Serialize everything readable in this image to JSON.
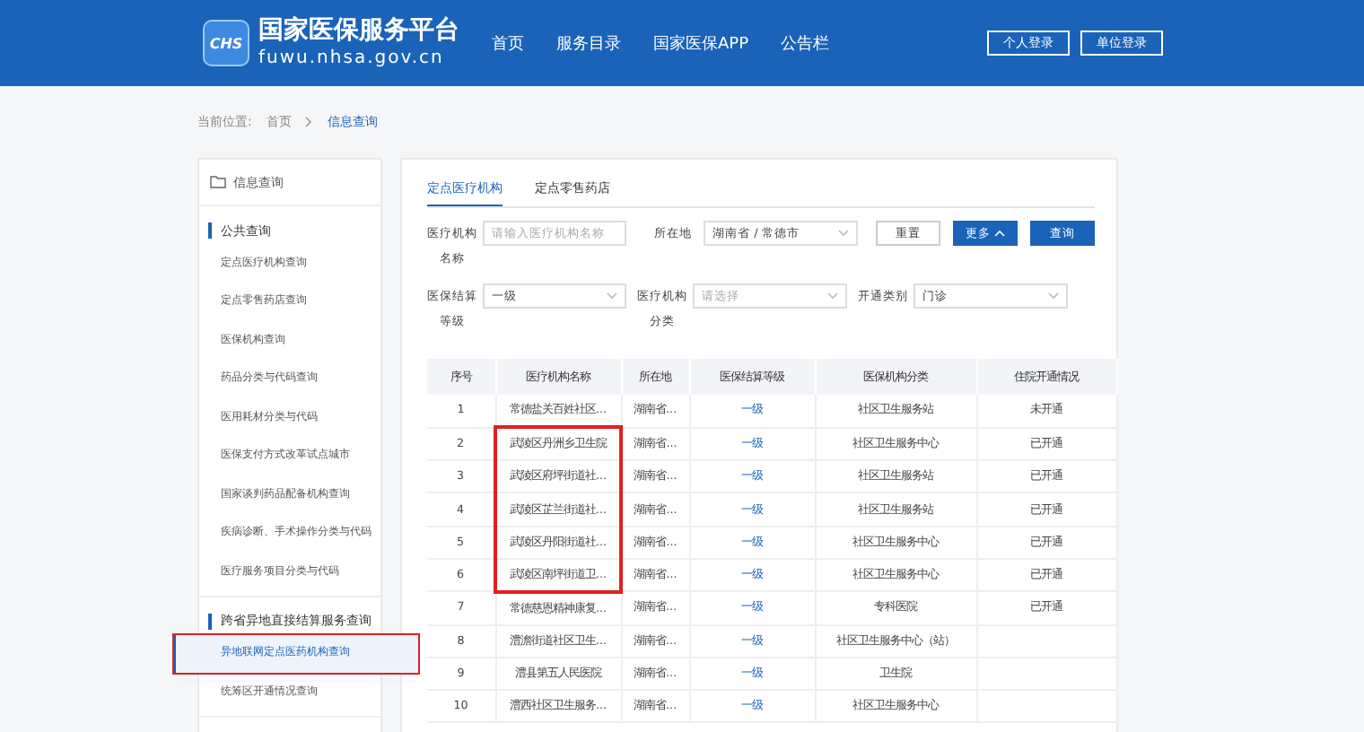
{
  "header": {
    "logo_badge": "CHS",
    "site_name": "国家医保服务平台",
    "site_url": "fuwu.nhsa.gov.cn",
    "nav": [
      {
        "label": "首页"
      },
      {
        "label": "服务目录"
      },
      {
        "label": "国家医保APP"
      },
      {
        "label": "公告栏"
      }
    ],
    "login_buttons": [
      "个人登录",
      "单位登录"
    ]
  },
  "breadcrumb": {
    "prefix": "当前位置:",
    "items": [
      {
        "label": "首页",
        "current": false
      },
      {
        "label": "信息查询",
        "current": true
      }
    ]
  },
  "sidebar": {
    "title": "信息查询",
    "groups": [
      {
        "title": "公共查询",
        "items": [
          {
            "label": "定点医疗机构查询",
            "selected": false,
            "circled": false
          },
          {
            "label": "定点零售药店查询",
            "selected": false,
            "circled": false
          },
          {
            "label": "医保机构查询",
            "selected": false,
            "circled": false
          },
          {
            "label": "药品分类与代码查询",
            "selected": false,
            "circled": false
          },
          {
            "label": "医用耗材分类与代码",
            "selected": false,
            "circled": false
          },
          {
            "label": "医保支付方式改革试点城市",
            "selected": false,
            "circled": false
          },
          {
            "label": "国家谈判药品配备机构查询",
            "selected": false,
            "circled": false
          },
          {
            "label": "疾病诊断、手术操作分类与代码",
            "selected": false,
            "circled": false
          },
          {
            "label": "医疗服务项目分类与代码",
            "selected": false,
            "circled": false
          }
        ]
      },
      {
        "title": "跨省异地直接结算服务查询",
        "items": [
          {
            "label": "异地联网定点医药机构查询",
            "selected": true,
            "circled": true
          },
          {
            "label": "统筹区开通情况查询",
            "selected": false,
            "circled": false
          }
        ]
      }
    ]
  },
  "tabs": [
    {
      "label": "定点医疗机构",
      "selected": true
    },
    {
      "label": "定点零售药店",
      "selected": false
    }
  ],
  "filters": [
    {
      "label": "医疗机构名称",
      "kind": "input",
      "placeholder": "请输入医疗机构名称"
    },
    {
      "label": "所在地",
      "kind": "select",
      "value": "湖南省 / 常德市"
    },
    {
      "label": "医保结算等级",
      "kind": "select",
      "value": "一级"
    },
    {
      "label": "医疗机构分类",
      "kind": "select",
      "placeholder": "请选择"
    },
    {
      "label": "开通类别",
      "kind": "select",
      "value": "门诊"
    }
  ],
  "actions": [
    {
      "label": "重置",
      "primary": false
    },
    {
      "label": "更多",
      "primary": true,
      "caret": true
    },
    {
      "label": "查询",
      "primary": true
    }
  ],
  "table": {
    "columns": [
      "序号",
      "医疗机构名称",
      "所在地",
      "医保结算等级",
      "医保机构分类",
      "住院开通情况"
    ],
    "rows": [
      {
        "cells": [
          "1",
          "常德盐关百姓社区...",
          "湖南省...",
          "一级",
          "社区卫生服务站",
          "未开通"
        ],
        "circled": false
      },
      {
        "cells": [
          "2",
          "武陵区丹洲乡卫生院",
          "湖南省...",
          "一级",
          "社区卫生服务中心",
          "已开通"
        ],
        "circled": true
      },
      {
        "cells": [
          "3",
          "武陵区府坪街道社...",
          "湖南省...",
          "一级",
          "社区卫生服务站",
          "已开通"
        ],
        "circled": true
      },
      {
        "cells": [
          "4",
          "武陵区芷兰街道社...",
          "湖南省...",
          "一级",
          "社区卫生服务站",
          "已开通"
        ],
        "circled": true
      },
      {
        "cells": [
          "5",
          "武陵区丹阳街道社...",
          "湖南省...",
          "一级",
          "社区卫生服务中心",
          "已开通"
        ],
        "circled": true
      },
      {
        "cells": [
          "6",
          "武陵区南坪街道卫...",
          "湖南省...",
          "一级",
          "社区卫生服务中心",
          "已开通"
        ],
        "circled": true
      },
      {
        "cells": [
          "7",
          "常德慈恩精神康复...",
          "湖南省...",
          "一级",
          "专科医院",
          "已开通"
        ],
        "circled": false
      },
      {
        "cells": [
          "8",
          "澧澹街道社区卫生...",
          "湖南省...",
          "一级",
          "社区卫生服务中心（站）"
        ],
        "circled": false
      },
      {
        "cells": [
          "9",
          "澧县第五人民医院",
          "湖南省...",
          "一级",
          "卫生院"
        ],
        "circled": false
      },
      {
        "cells": [
          "10",
          "澧西社区卫生服务...",
          "湖南省...",
          "一级",
          "社区卫生服务中心"
        ],
        "circled": false
      }
    ]
  }
}
